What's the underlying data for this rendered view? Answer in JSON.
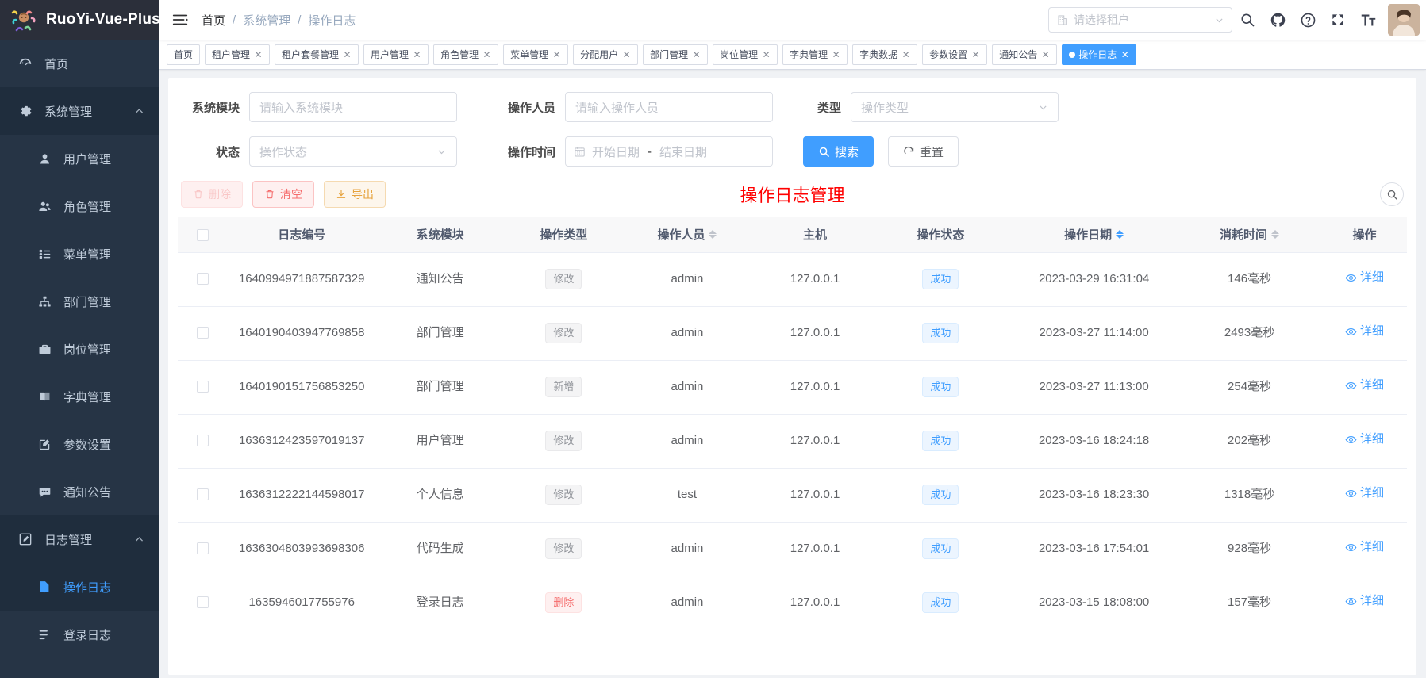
{
  "sidebar": {
    "logo_text": "RuoYi-Vue-Plus",
    "items": [
      {
        "label": "首页",
        "icon": "dashboard-icon",
        "type": "item",
        "state": "normal"
      },
      {
        "label": "系统管理",
        "icon": "gear-icon",
        "type": "group",
        "state": "open",
        "arrow": "chevron-up-icon"
      },
      {
        "label": "用户管理",
        "icon": "user-icon",
        "type": "child",
        "state": "normal"
      },
      {
        "label": "角色管理",
        "icon": "people-icon",
        "type": "child",
        "state": "normal"
      },
      {
        "label": "菜单管理",
        "icon": "list-icon",
        "type": "child",
        "state": "normal"
      },
      {
        "label": "部门管理",
        "icon": "tree-icon",
        "type": "child",
        "state": "normal"
      },
      {
        "label": "岗位管理",
        "icon": "post-icon",
        "type": "child",
        "state": "normal"
      },
      {
        "label": "字典管理",
        "icon": "book-icon",
        "type": "child",
        "state": "normal"
      },
      {
        "label": "参数设置",
        "icon": "edit-icon",
        "type": "child",
        "state": "normal"
      },
      {
        "label": "通知公告",
        "icon": "message-icon",
        "type": "child",
        "state": "normal"
      },
      {
        "label": "日志管理",
        "icon": "log-icon",
        "type": "group",
        "state": "open",
        "arrow": "chevron-up-icon"
      },
      {
        "label": "操作日志",
        "icon": "document-icon",
        "type": "child",
        "state": "active"
      },
      {
        "label": "登录日志",
        "icon": "login-icon",
        "type": "child",
        "state": "normal"
      }
    ]
  },
  "navbar": {
    "hamburger_icon": "hamburger-icon",
    "breadcrumb": [
      "首页",
      "系统管理",
      "操作日志"
    ],
    "tenant_select": {
      "placeholder": "请选择租户",
      "prefix_icon": "building-icon",
      "suffix_icon": "chevron-down-icon"
    },
    "icons": [
      "search-icon",
      "github-icon",
      "help-icon",
      "fullscreen-icon",
      "font-size-icon"
    ],
    "avatar": "avatar"
  },
  "tags": [
    {
      "label": "首页",
      "closable": false,
      "active": false
    },
    {
      "label": "租户管理",
      "closable": true,
      "active": false
    },
    {
      "label": "租户套餐管理",
      "closable": true,
      "active": false
    },
    {
      "label": "用户管理",
      "closable": true,
      "active": false
    },
    {
      "label": "角色管理",
      "closable": true,
      "active": false
    },
    {
      "label": "菜单管理",
      "closable": true,
      "active": false
    },
    {
      "label": "分配用户",
      "closable": true,
      "active": false
    },
    {
      "label": "部门管理",
      "closable": true,
      "active": false
    },
    {
      "label": "岗位管理",
      "closable": true,
      "active": false
    },
    {
      "label": "字典管理",
      "closable": true,
      "active": false
    },
    {
      "label": "字典数据",
      "closable": true,
      "active": false
    },
    {
      "label": "参数设置",
      "closable": true,
      "active": false
    },
    {
      "label": "通知公告",
      "closable": true,
      "active": false
    },
    {
      "label": "操作日志",
      "closable": true,
      "active": true
    }
  ],
  "search_form": {
    "module_label": "系统模块",
    "module_placeholder": "请输入系统模块",
    "operator_label": "操作人员",
    "operator_placeholder": "请输入操作人员",
    "type_label": "类型",
    "type_placeholder": "操作类型",
    "status_label": "状态",
    "status_placeholder": "操作状态",
    "time_label": "操作时间",
    "start_date_placeholder": "开始日期",
    "end_date_placeholder": "结束日期",
    "range_separator": "-",
    "search_button": "搜索",
    "reset_button": "重置",
    "search_icon": "search-icon",
    "reset_icon": "refresh-icon",
    "calendar_icon": "calendar-icon"
  },
  "toolbar": {
    "delete_label": "删除",
    "clear_label": "清空",
    "export_label": "导出",
    "delete_icon": "trash-icon",
    "clear_icon": "trash-icon",
    "export_icon": "download-icon",
    "page_title": "操作日志管理",
    "search_toggle_icon": "search-icon"
  },
  "table": {
    "columns": [
      {
        "key": "checkbox",
        "label": "",
        "sortable": false
      },
      {
        "key": "id",
        "label": "日志编号",
        "sortable": false
      },
      {
        "key": "module",
        "label": "系统模块",
        "sortable": false
      },
      {
        "key": "type",
        "label": "操作类型",
        "sortable": false
      },
      {
        "key": "operator",
        "label": "操作人员",
        "sortable": true,
        "sort_state": "none"
      },
      {
        "key": "host",
        "label": "主机",
        "sortable": false
      },
      {
        "key": "status",
        "label": "操作状态",
        "sortable": false
      },
      {
        "key": "date",
        "label": "操作日期",
        "sortable": true,
        "sort_state": "desc"
      },
      {
        "key": "cost",
        "label": "消耗时间",
        "sortable": true,
        "sort_state": "none"
      },
      {
        "key": "action",
        "label": "操作",
        "sortable": false
      }
    ],
    "detail_label": "详细",
    "detail_icon": "eye-icon",
    "rows": [
      {
        "id": "1640994971887587329",
        "module": "通知公告",
        "type": "修改",
        "type_style": "info",
        "operator": "admin",
        "host": "127.0.0.1",
        "status": "成功",
        "status_style": "success",
        "date": "2023-03-29 16:31:04",
        "cost": "146毫秒"
      },
      {
        "id": "1640190403947769858",
        "module": "部门管理",
        "type": "修改",
        "type_style": "info",
        "operator": "admin",
        "host": "127.0.0.1",
        "status": "成功",
        "status_style": "success",
        "date": "2023-03-27 11:14:00",
        "cost": "2493毫秒"
      },
      {
        "id": "1640190151756853250",
        "module": "部门管理",
        "type": "新增",
        "type_style": "info",
        "operator": "admin",
        "host": "127.0.0.1",
        "status": "成功",
        "status_style": "success",
        "date": "2023-03-27 11:13:00",
        "cost": "254毫秒"
      },
      {
        "id": "1636312423597019137",
        "module": "用户管理",
        "type": "修改",
        "type_style": "info",
        "operator": "admin",
        "host": "127.0.0.1",
        "status": "成功",
        "status_style": "success",
        "date": "2023-03-16 18:24:18",
        "cost": "202毫秒"
      },
      {
        "id": "1636312222144598017",
        "module": "个人信息",
        "type": "修改",
        "type_style": "info",
        "operator": "test",
        "host": "127.0.0.1",
        "status": "成功",
        "status_style": "success",
        "date": "2023-03-16 18:23:30",
        "cost": "1318毫秒"
      },
      {
        "id": "1636304803993698306",
        "module": "代码生成",
        "type": "修改",
        "type_style": "info",
        "operator": "admin",
        "host": "127.0.0.1",
        "status": "成功",
        "status_style": "success",
        "date": "2023-03-16 17:54:01",
        "cost": "928毫秒"
      },
      {
        "id": "1635946017755976",
        "module": "登录日志",
        "type": "删除",
        "type_style": "danger",
        "operator": "admin",
        "host": "127.0.0.1",
        "status": "成功",
        "status_style": "success",
        "date": "2023-03-15 18:08:00",
        "cost": "157毫秒"
      }
    ]
  },
  "colors": {
    "accent": "#409eff",
    "sidebar_bg": "#263445",
    "sidebar_sub_bg": "#1f2d3d",
    "title_red": "#ff0000",
    "danger": "#f56c6c",
    "warning": "#e6a23c"
  }
}
